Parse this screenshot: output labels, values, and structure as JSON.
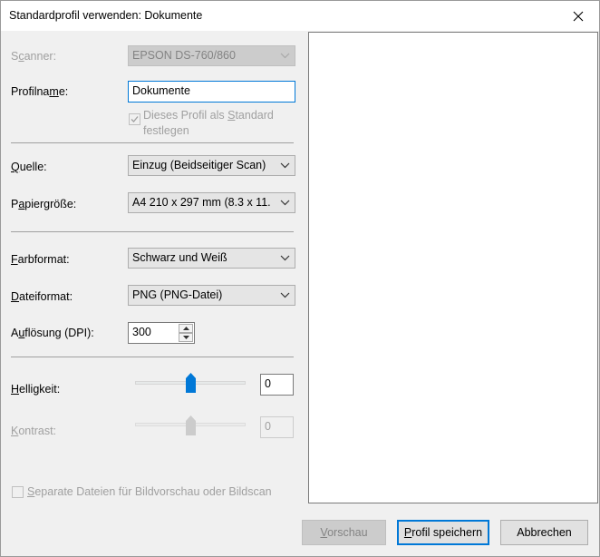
{
  "window": {
    "title": "Standardprofil verwenden: Dokumente"
  },
  "scanner": {
    "label_pre": "S",
    "label_accel": "c",
    "label_post": "anner:",
    "value": "EPSON DS-760/860"
  },
  "profile_name": {
    "label_pre": "Profilna",
    "label_accel": "m",
    "label_post": "e:",
    "value": "Dokumente"
  },
  "default_checkbox": {
    "label_pre": "Dieses Profil als ",
    "label_accel": "S",
    "label_post": "tandard",
    "label_line2": "festlegen"
  },
  "source": {
    "label_pre": "",
    "label_accel": "Q",
    "label_post": "uelle:",
    "value": "Einzug (Beidseitiger Scan)"
  },
  "paper_size": {
    "label_pre": "P",
    "label_accel": "a",
    "label_post": "piergröße:",
    "value": "A4 210 x 297 mm (8.3 x 11."
  },
  "color_format": {
    "label_pre": "",
    "label_accel": "F",
    "label_post": "arbformat:",
    "value": "Schwarz und Weiß"
  },
  "file_format": {
    "label_pre": "",
    "label_accel": "D",
    "label_post": "ateiformat:",
    "value": "PNG (PNG-Datei)"
  },
  "resolution": {
    "label_pre": "A",
    "label_accel": "u",
    "label_post": "flösung (DPI):",
    "value": "300"
  },
  "brightness": {
    "label_pre": "",
    "label_accel": "H",
    "label_post": "elligkeit:",
    "value": "0",
    "level": 0.5
  },
  "contrast": {
    "label_pre": "",
    "label_accel": "K",
    "label_post": "ontrast:",
    "value": "0",
    "level": 0.5
  },
  "separate_files": {
    "label_pre": "",
    "label_accel": "S",
    "label_post": "eparate Dateien für Bildvorschau oder Bildscan"
  },
  "buttons": {
    "preview": {
      "label_accel": "V",
      "label_post": "orschau"
    },
    "save": {
      "label_pre": "",
      "label_accel": "P",
      "label_post": "rofil speichern"
    },
    "cancel": "Abbrechen"
  },
  "colors": {
    "accent": "#0078d7",
    "disabled_text": "#a0a0a0"
  }
}
